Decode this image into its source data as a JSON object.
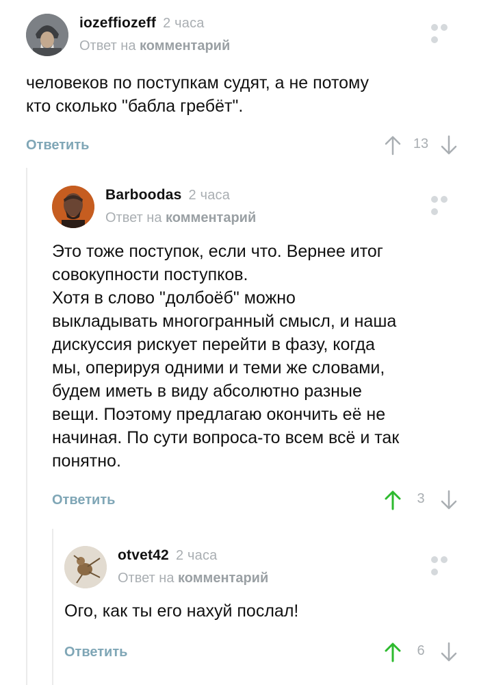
{
  "comments": [
    {
      "author": "iozeffiozeff",
      "time": "2 часа",
      "reply_prefix": "Ответ на",
      "reply_target": "комментарий",
      "text": "человеков по поступкам судят, а не потому\nкто сколько \"бабла гребёт\".",
      "reply_label": "Ответить",
      "rating": "13",
      "upvoted": false
    },
    {
      "author": "Barboodas",
      "time": "2 часа",
      "reply_prefix": "Ответ на",
      "reply_target": "комментарий",
      "text": "Это тоже поступок, если что. Вернее итог\nсовокупности поступков.\nХотя в слово \"долбоёб\" можно\nвыкладывать многогранный смысл, и наша\nдискуссия рискует перейти в фазу, когда\nмы, оперируя одними и теми же словами,\nбудем иметь в виду абсолютно разные\nвещи. Поэтому предлагаю окончить её не\nначиная. По сути вопроса-то всем всё и так\nпонятно.",
      "reply_label": "Ответить",
      "rating": "3",
      "upvoted": true
    },
    {
      "author": "otvet42",
      "time": "2 часа",
      "reply_prefix": "Ответ на",
      "reply_target": "комментарий",
      "text": "Ого, как ты его нахуй послал!",
      "reply_label": "Ответить",
      "rating": "6",
      "upvoted": true
    }
  ],
  "colors": {
    "upvote_active": "#2dba2e",
    "vote_inactive": "#a9aeb2",
    "reply_link": "#7fa6b6"
  },
  "icons": {
    "more": "more-dots-icon",
    "upvote": "arrow-up-icon",
    "downvote": "arrow-down-icon"
  }
}
